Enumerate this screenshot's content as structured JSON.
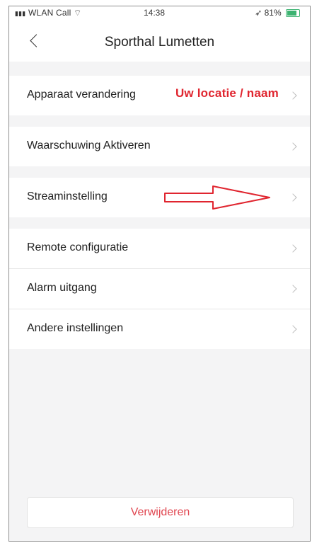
{
  "status_bar": {
    "carrier": "WLAN Call",
    "time": "14:38",
    "battery": "81%"
  },
  "header": {
    "title": "Sporthal Lumetten"
  },
  "sections": [
    {
      "items": [
        {
          "label": "Apparaat verandering",
          "annotation": "Uw locatie / naam"
        }
      ]
    },
    {
      "items": [
        {
          "label": "Waarschuwing Aktiveren"
        }
      ]
    },
    {
      "items": [
        {
          "label": "Streaminstelling"
        }
      ]
    },
    {
      "items": [
        {
          "label": "Remote configuratie"
        },
        {
          "label": "Alarm uitgang"
        },
        {
          "label": "Andere instellingen"
        }
      ]
    }
  ],
  "footer": {
    "delete_label": "Verwijderen"
  },
  "colors": {
    "annotation": "#e0252f",
    "delete": "#e0454f",
    "background": "#f4f4f5"
  },
  "icons": [
    "signal-icon",
    "wifi-icon",
    "battery-icon",
    "back-chevron-icon",
    "chevron-right-icon",
    "red-arrow-annotation"
  ]
}
